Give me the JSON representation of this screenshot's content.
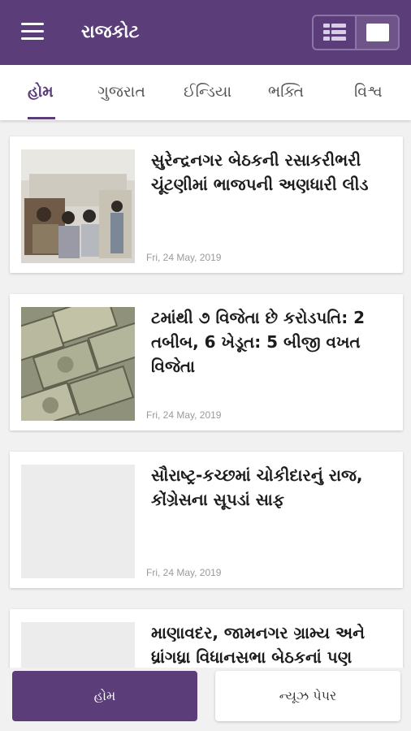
{
  "app_title": "રાજકોટ",
  "colors": {
    "brand": "#5b3d79",
    "background": "#f1f1f1"
  },
  "view_toggle": {
    "list_icon": "list-view-icon",
    "card_icon": "card-view-icon"
  },
  "tabs": [
    {
      "label": "હોમ"
    },
    {
      "label": "ગુજરાત"
    },
    {
      "label": "ઈન્ડિયા"
    },
    {
      "label": "ભક્તિ"
    },
    {
      "label": "વિશ્વ"
    }
  ],
  "articles": [
    {
      "title": "સુરેન્દ્રનગર બેઠકની રસાકરીભરી ચૂંટણીમાં ભાજપની અણધારી લીડ",
      "date": "Fri, 24 May, 2019",
      "image": "counting-hall-photo"
    },
    {
      "title": "ટમાંથી ૭ વિજેતા છે કરોડપતિ: 2 તબીબ, 6 ખેડૂત: 5 બીજી વખત વિજેતા",
      "date": "Fri, 24 May, 2019",
      "image": "currency-notes-photo"
    },
    {
      "title": "સૌરાષ્ટ્ર-કચ્છમાં ચોકીદારનું રાજ, કોંગ્રેસના સૂપડાં સાફ",
      "date": "Fri, 24 May, 2019",
      "image": "placeholder"
    },
    {
      "title": "માણાવદર, જામનગર ગ્રામ્ય અને ધ્રાંગધ્રા વિધાનસભા બેઠકનાં પણ",
      "date": "",
      "image": "placeholder"
    }
  ],
  "bottom_nav": {
    "home_label": "હોમ",
    "newspaper_label": "ન્યૂઝ પેપર"
  }
}
